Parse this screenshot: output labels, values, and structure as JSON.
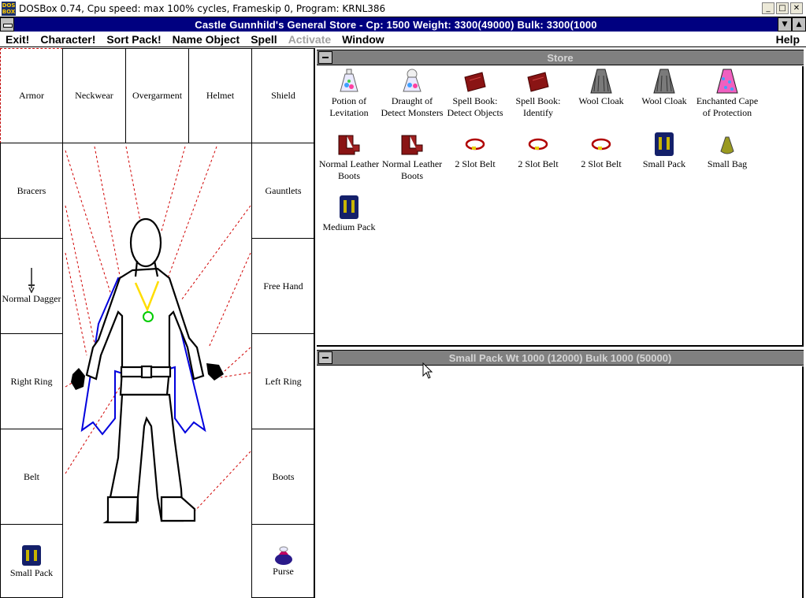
{
  "dosbox": {
    "title": "DOSBox 0.74, Cpu speed: max 100% cycles, Frameskip  0, Program:  KRNL386",
    "icon_text": "DOS BOX",
    "buttons": [
      "_",
      "□",
      "✕"
    ]
  },
  "window": {
    "title": "Castle Gunnhild's General Store - Cp: 1500 Weight: 3300(49000) Bulk: 3300(1000"
  },
  "menu": [
    {
      "label": "Exit!",
      "enabled": true
    },
    {
      "label": "Character!",
      "enabled": true
    },
    {
      "label": "Sort Pack!",
      "enabled": true
    },
    {
      "label": "Name Object",
      "enabled": true
    },
    {
      "label": "Spell",
      "enabled": true
    },
    {
      "label": "Activate",
      "enabled": false
    },
    {
      "label": "Window",
      "enabled": true
    }
  ],
  "help_label": "Help",
  "equipment": {
    "armor": "Armor",
    "neckwear": "Neckwear",
    "overgarment": "Overgarment",
    "helmet": "Helmet",
    "shield": "Shield",
    "bracers": "Bracers",
    "gauntlets": "Gauntlets",
    "weapon": "Normal Dagger",
    "free_hand": "Free Hand",
    "right_ring": "Right Ring",
    "left_ring": "Left Ring",
    "belt": "Belt",
    "boots": "Boots",
    "pack": "Small Pack",
    "purse": "Purse"
  },
  "store": {
    "title": "Store",
    "items": [
      {
        "label": "Potion of Levitation",
        "icon": "potion-icon"
      },
      {
        "label": "Draught of Detect Monsters",
        "icon": "draught-icon"
      },
      {
        "label": "Spell Book: Detect Objects",
        "icon": "spellbook-icon"
      },
      {
        "label": "Spell Book: Identify",
        "icon": "spellbook-icon"
      },
      {
        "label": "Wool Cloak",
        "icon": "cloak-icon"
      },
      {
        "label": "Wool Cloak",
        "icon": "cloak-icon"
      },
      {
        "label": "Enchanted Cape of Protection",
        "icon": "cape-icon"
      },
      {
        "label": "Normal Leather Boots",
        "icon": "boots-icon"
      },
      {
        "label": "Normal Leather Boots",
        "icon": "boots-icon"
      },
      {
        "label": "2 Slot Belt",
        "icon": "belt-icon"
      },
      {
        "label": "2 Slot Belt",
        "icon": "belt-icon"
      },
      {
        "label": "2 Slot Belt",
        "icon": "belt-icon"
      },
      {
        "label": "Small Pack",
        "icon": "pack-icon"
      },
      {
        "label": "Small Bag",
        "icon": "bag-icon"
      },
      {
        "label": "Medium Pack",
        "icon": "pack-icon"
      }
    ]
  },
  "pack": {
    "title": "Small Pack Wt 1000 (12000) Bulk 1000 (50000)",
    "items": []
  }
}
